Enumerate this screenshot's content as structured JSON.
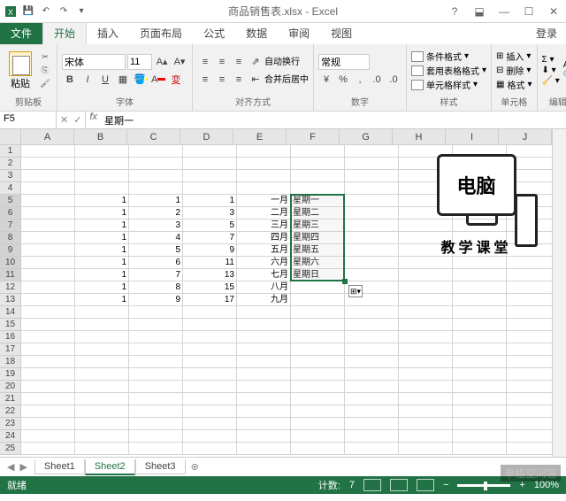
{
  "app": {
    "title": "商品销售表.xlsx - Excel"
  },
  "tabs": {
    "file": "文件",
    "home": "开始",
    "insert": "插入",
    "layout": "页面布局",
    "formula": "公式",
    "data": "数据",
    "review": "审阅",
    "view": "视图",
    "signin": "登录"
  },
  "ribbon": {
    "clipboard": {
      "paste": "粘贴",
      "label": "剪贴板"
    },
    "font": {
      "name": "宋体",
      "size": "11",
      "label": "字体"
    },
    "align": {
      "wrap": "自动换行",
      "merge": "合并后居中",
      "label": "对齐方式"
    },
    "number": {
      "format": "常规",
      "label": "数字"
    },
    "styles": {
      "cond": "条件格式",
      "table": "套用表格格式",
      "cell": "单元格样式",
      "label": "样式"
    },
    "cells": {
      "insert": "插入",
      "delete": "删除",
      "format": "格式",
      "label": "单元格"
    },
    "editing": {
      "label": "编辑"
    }
  },
  "namebox": "F5",
  "formula": "星期一",
  "columns": [
    "A",
    "B",
    "C",
    "D",
    "E",
    "F",
    "G",
    "H",
    "I",
    "J"
  ],
  "rows_count": 25,
  "selected_rows": [
    5,
    6,
    7,
    8,
    9,
    10,
    11
  ],
  "cells": {
    "B": [
      "1",
      "1",
      "1",
      "1",
      "1",
      "1",
      "1",
      "1",
      "1"
    ],
    "C": [
      "1",
      "2",
      "3",
      "4",
      "5",
      "6",
      "7",
      "8",
      "9"
    ],
    "D": [
      "1",
      "3",
      "5",
      "7",
      "9",
      "11",
      "13",
      "15",
      "17"
    ],
    "E": [
      "一月",
      "二月",
      "三月",
      "四月",
      "五月",
      "六月",
      "七月",
      "八月",
      "九月"
    ],
    "F": [
      "星期一",
      "星期二",
      "星期三",
      "星期四",
      "星期五",
      "星期六",
      "星期日"
    ]
  },
  "overlay": {
    "monitor": "电脑",
    "caption": "教学课堂"
  },
  "sheets": {
    "s1": "Sheet1",
    "s2": "Sheet2",
    "s3": "Sheet3"
  },
  "status": {
    "ready": "就绪",
    "count_label": "计数:",
    "count": "7",
    "zoom": "100%"
  },
  "watermark": "单格空问答"
}
